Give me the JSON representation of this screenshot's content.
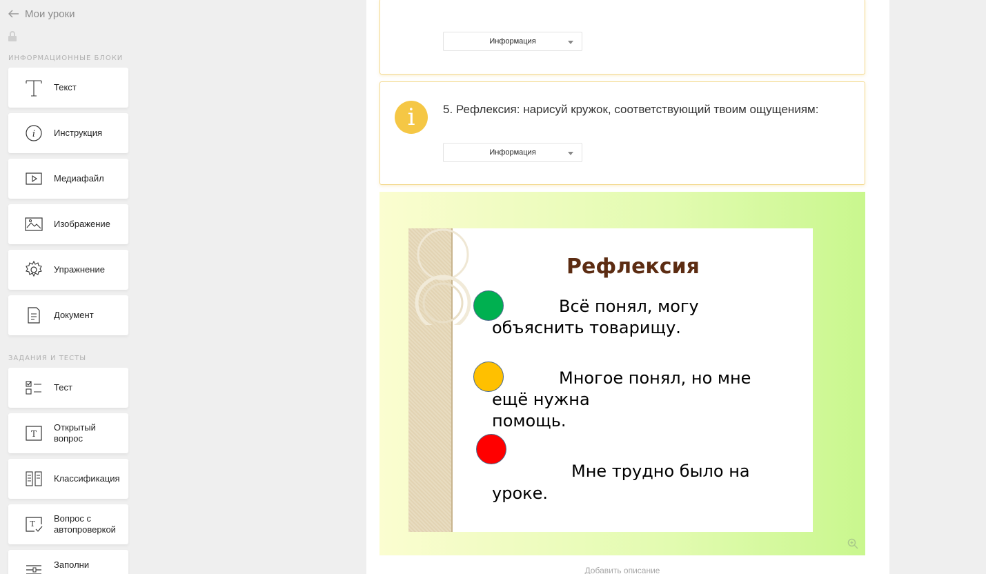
{
  "nav": {
    "back_label": "Мои уроки"
  },
  "sidebar": {
    "info_section_title": "ИНФОРМАЦИОННЫЕ БЛОКИ",
    "info_blocks": [
      {
        "label": "Текст",
        "icon": "text-icon"
      },
      {
        "label": "Инструкция",
        "icon": "instruction-icon"
      },
      {
        "label": "Медиафайл",
        "icon": "media-icon"
      },
      {
        "label": "Изображение",
        "icon": "image-icon"
      },
      {
        "label": "Упражнение",
        "icon": "gear-icon"
      },
      {
        "label": "Документ",
        "icon": "document-icon"
      }
    ],
    "tasks_section_title": "ЗАДАНИЯ И ТЕСТЫ",
    "task_blocks": [
      {
        "label": "Тест",
        "icon": "checklist-icon"
      },
      {
        "label": "Открытый вопрос",
        "icon": "open-question-icon"
      },
      {
        "label": "Классификация",
        "icon": "classification-icon"
      },
      {
        "label": "Вопрос с автопроверкой",
        "icon": "auto-check-icon"
      },
      {
        "label": "Заполни",
        "icon": "fill-icon"
      }
    ]
  },
  "main": {
    "card1": {
      "dropdown_value": "Информация"
    },
    "card2": {
      "title": "5. Рефлексия: нарисуй кружок, соответствующий твоим ощущениям:",
      "dropdown_value": "Информация",
      "icon_glyph": "i"
    },
    "slide": {
      "title": "Рефлексия",
      "items": [
        {
          "color": "#00b050",
          "line1": "Всё понял, могу",
          "line2": "объяснить товарищу."
        },
        {
          "color": "#ffc000",
          "line1": "Многое понял, но мне",
          "line2": "ещё нужна",
          "line3": "помощь."
        },
        {
          "color": "#ff0000",
          "line1": "Мне трудно было на",
          "line2": "уроке."
        }
      ]
    },
    "add_description": "Добавить описание"
  },
  "colors": {
    "accent_yellow": "#f5c745",
    "card_border": "#f3d98f"
  }
}
